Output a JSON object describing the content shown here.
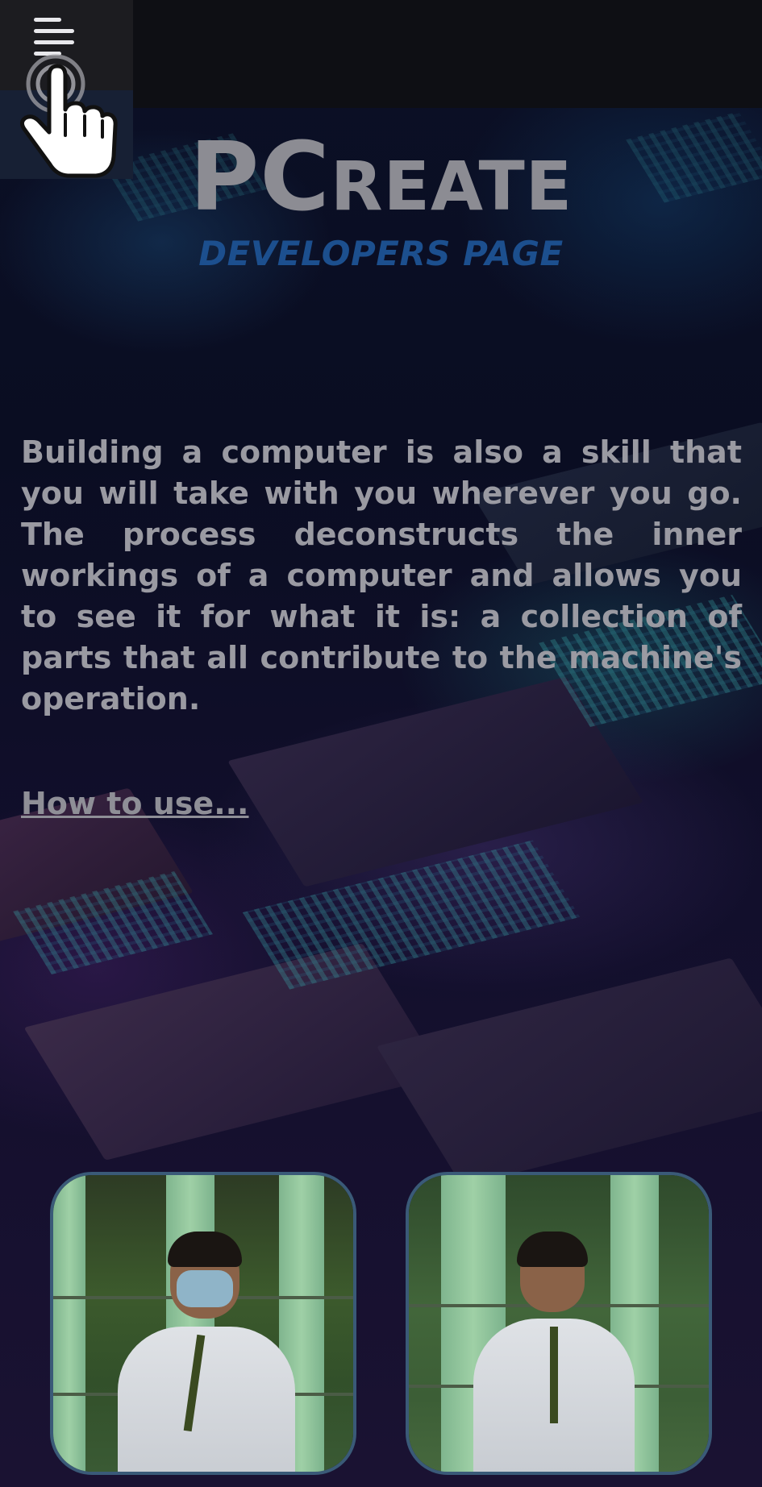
{
  "header": {
    "menu_icon": "hamburger-menu-icon",
    "tap_hint_icon": "tap-hand-icon"
  },
  "brand": {
    "title_big": "PC",
    "title_rest": "REATE",
    "subtitle": "DEVELOPERS PAGE"
  },
  "intro": {
    "text": "Building a computer is also a skill that you will take with you wherever you go. The process deconstructs the inner workings of a computer and allows you to see it for what it is: a collection of parts that all contribute to the machine's operation."
  },
  "links": {
    "how_to_use": "How to use..."
  },
  "developers": [
    {
      "photo": "developer-photo-1"
    },
    {
      "photo": "developer-photo-2"
    }
  ],
  "colors": {
    "title": "#8c8c93",
    "subtitle": "#1c4f8e",
    "body_text": "#9a9aa2",
    "card_border": "#3a5a78"
  }
}
